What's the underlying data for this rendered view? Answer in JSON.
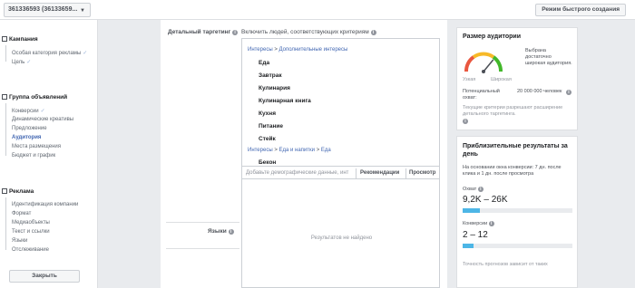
{
  "topbar": {
    "account": "361336593 (36133659...",
    "quick_mode": "Режим быстрого создания"
  },
  "sidebar": {
    "campaign": {
      "title": "Кампания",
      "items": [
        {
          "label": "Особая категория рекламы",
          "done": true
        },
        {
          "label": "Цель",
          "done": true
        }
      ]
    },
    "adset": {
      "title": "Группа объявлений",
      "items": [
        {
          "label": "Конверсии",
          "done": true
        },
        {
          "label": "Динамические креативы",
          "done": false
        },
        {
          "label": "Предложение",
          "done": false
        },
        {
          "label": "Аудитория",
          "active": true
        },
        {
          "label": "Места размещения",
          "done": false
        },
        {
          "label": "Бюджет и график",
          "done": false
        }
      ]
    },
    "ad": {
      "title": "Реклама",
      "items": [
        {
          "label": "Идентификация компании"
        },
        {
          "label": "Формат"
        },
        {
          "label": "Медиаобъекты"
        },
        {
          "label": "Текст и ссылки"
        },
        {
          "label": "Языки"
        },
        {
          "label": "Отслеживание"
        }
      ]
    },
    "close_label": "Закрыть",
    "check_glyph": "✓"
  },
  "main": {
    "detailed_targeting_label": "Детальный таргетинг",
    "include_label": "Включить людей, соответствующих критериям",
    "languages_label": "Языки",
    "picker": {
      "crumb1": {
        "a": "Интересы",
        "sep": ">",
        "b": "Дополнительные интересы"
      },
      "items": [
        "Еда",
        "Завтрак",
        "Кулинария",
        "Кулинарная книга",
        "Кухня",
        "Питание",
        "Стейк"
      ],
      "crumb2": {
        "a": "Интересы",
        "sep": ">",
        "b": "Еда и напитки",
        "sep2": ">",
        "c": "Еда"
      },
      "cut_item": "Бекон"
    },
    "search": {
      "placeholder": "Добавьте демографические данные, инт",
      "tab_recommendations": "Рекомендации",
      "tab_browse": "Просмотр"
    },
    "no_results": "Результатов не найдено"
  },
  "audience_size": {
    "title": "Размер аудитории",
    "verdict": "Выбрана достаточно широкая аудитория.",
    "narrow": "Узкая",
    "broad": "Широкая",
    "potential_label": "Потенциальный охват:",
    "potential_value": "20 000 000 человек",
    "note": "Текущие критерии разрешают расширение детального таргетинга.",
    "gauge_level": 0.72
  },
  "estimates": {
    "title": "Приблизительные результаты за день",
    "basis": "На основании окна конверсии: 7 дн. после клика и 1 дн. после просмотра",
    "reach_label": "Охват",
    "reach_value": "9,2K – 26K",
    "reach_fill": 0.16,
    "conv_label": "Конверсии",
    "conv_value": "2 – 12",
    "conv_fill": 0.1,
    "accuracy_note": "Точность прогнозов зависит от таких"
  },
  "colors": {
    "accent": "#4267b2",
    "bar": "#4db6e6",
    "gauge_green": "#42b72a",
    "gauge_red": "#e9573f"
  }
}
